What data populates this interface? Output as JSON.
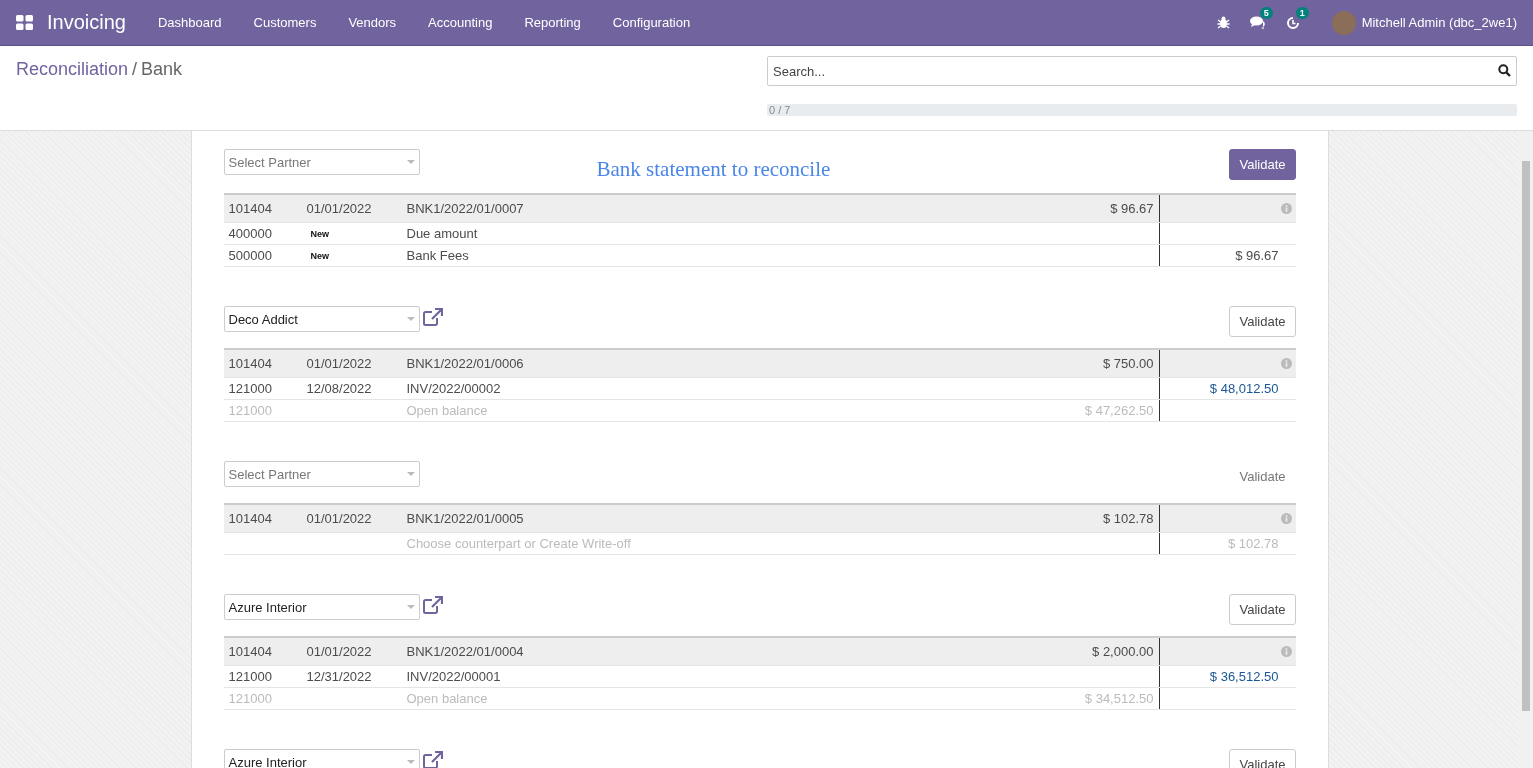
{
  "navbar": {
    "app_name": "Invoicing",
    "menu": [
      "Dashboard",
      "Customers",
      "Vendors",
      "Accounting",
      "Reporting",
      "Configuration"
    ],
    "messages_count": "5",
    "activities_count": "1",
    "user": "Mitchell Admin (dbc_2we1)"
  },
  "breadcrumb": {
    "parent": "Reconciliation",
    "separator": "/",
    "current": "Bank"
  },
  "search": {
    "placeholder": "Search..."
  },
  "progress": {
    "label": "0 / 7",
    "level": 0
  },
  "title": "Bank statement to reconcile",
  "statements": [
    {
      "partner": {
        "placeholder": "Select Partner"
      },
      "partner_link": false,
      "validate": {
        "label": "Validate",
        "kind": "primary"
      },
      "header": {
        "account": "101404",
        "date": "01/01/2022",
        "reference": "BNK1/2022/01/0007",
        "amount": "$ 96.67"
      },
      "lines": [
        {
          "kind": "new",
          "account": "400000",
          "badge": "New",
          "label": "Due amount"
        },
        {
          "kind": "new",
          "account": "500000",
          "badge": "New",
          "label": "Bank Fees",
          "counterpart_amount": "$ 96.67"
        }
      ]
    },
    {
      "partner": {
        "value": "Deco Addict"
      },
      "partner_link": true,
      "validate": {
        "label": "Validate",
        "kind": "default"
      },
      "header": {
        "account": "101404",
        "date": "01/01/2022",
        "reference": "BNK1/2022/01/0006",
        "amount": "$ 750.00"
      },
      "lines": [
        {
          "kind": "move",
          "account": "121000",
          "date": "12/08/2022",
          "label": "INV/2022/00002",
          "counterpart_amount": "$ 48,012.50"
        },
        {
          "kind": "open",
          "account": "121000",
          "label": "Open balance",
          "amount": "$ 47,262.50"
        }
      ]
    },
    {
      "partner": {
        "placeholder": "Select Partner"
      },
      "partner_link": false,
      "validate": {
        "label": "Validate",
        "kind": "disabled"
      },
      "header": {
        "account": "101404",
        "date": "01/01/2022",
        "reference": "BNK1/2022/01/0005",
        "amount": "$ 102.78"
      },
      "lines": [
        {
          "kind": "choose",
          "label": "Choose counterpart or Create Write-off",
          "counterpart_amount": "$ 102.78"
        }
      ]
    },
    {
      "partner": {
        "value": "Azure Interior"
      },
      "partner_link": true,
      "validate": {
        "label": "Validate",
        "kind": "default"
      },
      "header": {
        "account": "101404",
        "date": "01/01/2022",
        "reference": "BNK1/2022/01/0004",
        "amount": "$ 2,000.00"
      },
      "lines": [
        {
          "kind": "move",
          "account": "121000",
          "date": "12/31/2022",
          "label": "INV/2022/00001",
          "counterpart_amount": "$ 36,512.50"
        },
        {
          "kind": "open",
          "account": "121000",
          "label": "Open balance",
          "amount": "$ 34,512.50"
        }
      ]
    },
    {
      "partner": {
        "value": "Azure Interior"
      },
      "partner_link": true,
      "validate": {
        "label": "Validate",
        "kind": "default"
      }
    }
  ]
}
